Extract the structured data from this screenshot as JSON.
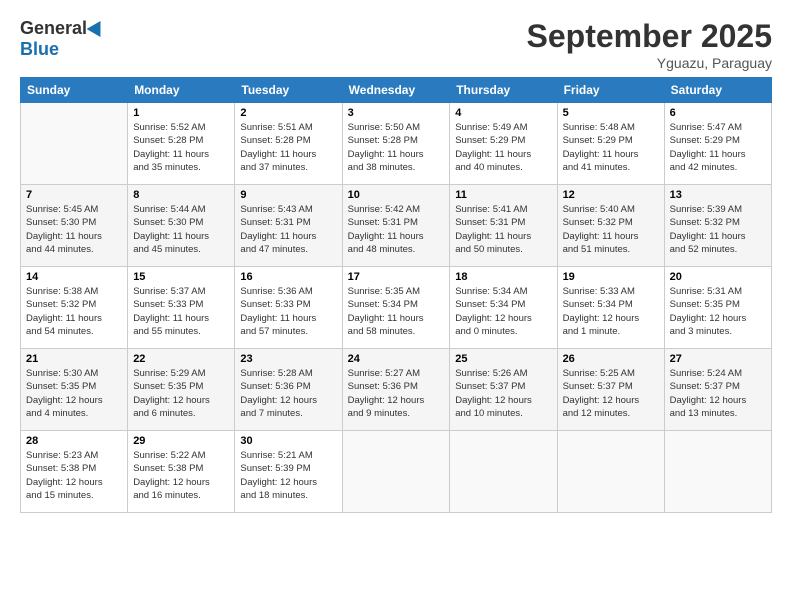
{
  "logo": {
    "general": "General",
    "blue": "Blue"
  },
  "title": "September 2025",
  "location": "Yguazu, Paraguay",
  "weekdays": [
    "Sunday",
    "Monday",
    "Tuesday",
    "Wednesday",
    "Thursday",
    "Friday",
    "Saturday"
  ],
  "weeks": [
    [
      {
        "day": "",
        "info": ""
      },
      {
        "day": "1",
        "info": "Sunrise: 5:52 AM\nSunset: 5:28 PM\nDaylight: 11 hours\nand 35 minutes."
      },
      {
        "day": "2",
        "info": "Sunrise: 5:51 AM\nSunset: 5:28 PM\nDaylight: 11 hours\nand 37 minutes."
      },
      {
        "day": "3",
        "info": "Sunrise: 5:50 AM\nSunset: 5:28 PM\nDaylight: 11 hours\nand 38 minutes."
      },
      {
        "day": "4",
        "info": "Sunrise: 5:49 AM\nSunset: 5:29 PM\nDaylight: 11 hours\nand 40 minutes."
      },
      {
        "day": "5",
        "info": "Sunrise: 5:48 AM\nSunset: 5:29 PM\nDaylight: 11 hours\nand 41 minutes."
      },
      {
        "day": "6",
        "info": "Sunrise: 5:47 AM\nSunset: 5:29 PM\nDaylight: 11 hours\nand 42 minutes."
      }
    ],
    [
      {
        "day": "7",
        "info": "Sunrise: 5:45 AM\nSunset: 5:30 PM\nDaylight: 11 hours\nand 44 minutes."
      },
      {
        "day": "8",
        "info": "Sunrise: 5:44 AM\nSunset: 5:30 PM\nDaylight: 11 hours\nand 45 minutes."
      },
      {
        "day": "9",
        "info": "Sunrise: 5:43 AM\nSunset: 5:31 PM\nDaylight: 11 hours\nand 47 minutes."
      },
      {
        "day": "10",
        "info": "Sunrise: 5:42 AM\nSunset: 5:31 PM\nDaylight: 11 hours\nand 48 minutes."
      },
      {
        "day": "11",
        "info": "Sunrise: 5:41 AM\nSunset: 5:31 PM\nDaylight: 11 hours\nand 50 minutes."
      },
      {
        "day": "12",
        "info": "Sunrise: 5:40 AM\nSunset: 5:32 PM\nDaylight: 11 hours\nand 51 minutes."
      },
      {
        "day": "13",
        "info": "Sunrise: 5:39 AM\nSunset: 5:32 PM\nDaylight: 11 hours\nand 52 minutes."
      }
    ],
    [
      {
        "day": "14",
        "info": "Sunrise: 5:38 AM\nSunset: 5:32 PM\nDaylight: 11 hours\nand 54 minutes."
      },
      {
        "day": "15",
        "info": "Sunrise: 5:37 AM\nSunset: 5:33 PM\nDaylight: 11 hours\nand 55 minutes."
      },
      {
        "day": "16",
        "info": "Sunrise: 5:36 AM\nSunset: 5:33 PM\nDaylight: 11 hours\nand 57 minutes."
      },
      {
        "day": "17",
        "info": "Sunrise: 5:35 AM\nSunset: 5:34 PM\nDaylight: 11 hours\nand 58 minutes."
      },
      {
        "day": "18",
        "info": "Sunrise: 5:34 AM\nSunset: 5:34 PM\nDaylight: 12 hours\nand 0 minutes."
      },
      {
        "day": "19",
        "info": "Sunrise: 5:33 AM\nSunset: 5:34 PM\nDaylight: 12 hours\nand 1 minute."
      },
      {
        "day": "20",
        "info": "Sunrise: 5:31 AM\nSunset: 5:35 PM\nDaylight: 12 hours\nand 3 minutes."
      }
    ],
    [
      {
        "day": "21",
        "info": "Sunrise: 5:30 AM\nSunset: 5:35 PM\nDaylight: 12 hours\nand 4 minutes."
      },
      {
        "day": "22",
        "info": "Sunrise: 5:29 AM\nSunset: 5:35 PM\nDaylight: 12 hours\nand 6 minutes."
      },
      {
        "day": "23",
        "info": "Sunrise: 5:28 AM\nSunset: 5:36 PM\nDaylight: 12 hours\nand 7 minutes."
      },
      {
        "day": "24",
        "info": "Sunrise: 5:27 AM\nSunset: 5:36 PM\nDaylight: 12 hours\nand 9 minutes."
      },
      {
        "day": "25",
        "info": "Sunrise: 5:26 AM\nSunset: 5:37 PM\nDaylight: 12 hours\nand 10 minutes."
      },
      {
        "day": "26",
        "info": "Sunrise: 5:25 AM\nSunset: 5:37 PM\nDaylight: 12 hours\nand 12 minutes."
      },
      {
        "day": "27",
        "info": "Sunrise: 5:24 AM\nSunset: 5:37 PM\nDaylight: 12 hours\nand 13 minutes."
      }
    ],
    [
      {
        "day": "28",
        "info": "Sunrise: 5:23 AM\nSunset: 5:38 PM\nDaylight: 12 hours\nand 15 minutes."
      },
      {
        "day": "29",
        "info": "Sunrise: 5:22 AM\nSunset: 5:38 PM\nDaylight: 12 hours\nand 16 minutes."
      },
      {
        "day": "30",
        "info": "Sunrise: 5:21 AM\nSunset: 5:39 PM\nDaylight: 12 hours\nand 18 minutes."
      },
      {
        "day": "",
        "info": ""
      },
      {
        "day": "",
        "info": ""
      },
      {
        "day": "",
        "info": ""
      },
      {
        "day": "",
        "info": ""
      }
    ]
  ]
}
